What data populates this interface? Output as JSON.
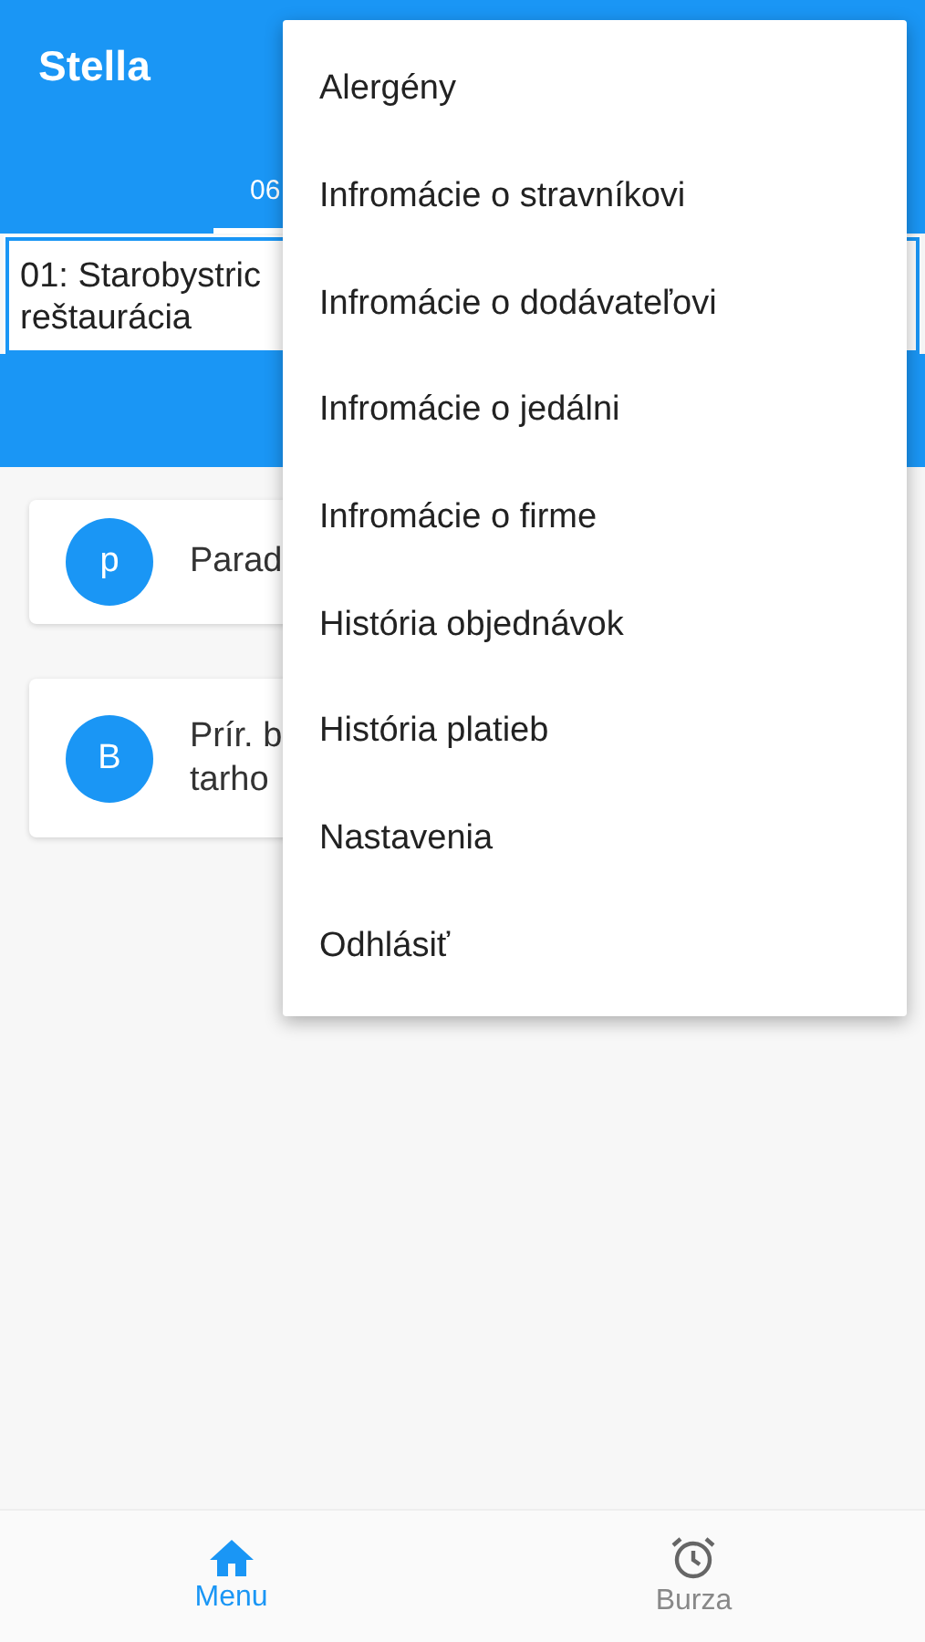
{
  "app_bar": {
    "title": "Stella"
  },
  "tabs": [
    {
      "label": "06",
      "selected": true
    }
  ],
  "canteen_select": {
    "lines": [
      "01: Starobystric",
      "reštaurácia"
    ]
  },
  "cards": [
    {
      "avatar": "p",
      "lines": [
        "Parad"
      ]
    },
    {
      "avatar": "B",
      "lines": [
        "Prír. b",
        "tarho"
      ]
    }
  ],
  "popup_menu": {
    "items": [
      "Alergény",
      "Infromácie o stravníkovi",
      "Infromácie o dodávateľovi",
      "Infromácie o jedálni",
      "Infromácie o firme",
      "História objednávok",
      "História platieb",
      "Nastavenia",
      "Odhlásiť"
    ]
  },
  "bottom_nav": [
    {
      "label": "Menu",
      "kind": "home",
      "selected": true
    },
    {
      "label": "Burza",
      "kind": "alarm",
      "selected": false
    }
  ]
}
